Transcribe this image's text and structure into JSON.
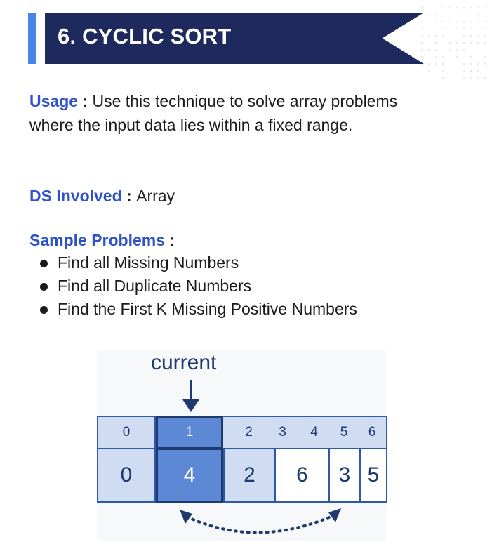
{
  "section": {
    "title": "6. CYCLIC SORT"
  },
  "usage": {
    "label": "Usage",
    "separator": " : ",
    "text": "Use this technique to solve array problems where the input data lies within a fixed range."
  },
  "ds_involved": {
    "label": "DS Involved",
    "separator": " : ",
    "value": "Array"
  },
  "sample_problems": {
    "label": "Sample Problems",
    "separator": " :",
    "items": [
      "Find all Missing Numbers",
      "Find all Duplicate Numbers",
      "Find the First K Missing Positive Numbers"
    ]
  },
  "diagram": {
    "pointer_label": "current",
    "indices": [
      "0",
      "1",
      "2",
      "3",
      "4",
      "5",
      "6"
    ],
    "values": [
      "0",
      "4",
      "2",
      "6",
      "3",
      "5"
    ],
    "current_index": 1,
    "colors": {
      "light_cell": "#cfdcf2",
      "active_cell": "#5d88d6",
      "border": "#2d5aa8",
      "text": "#1e3a6e"
    }
  },
  "colors": {
    "banner": "#1e2a5e",
    "banner_accent": "#4a86e8",
    "keyword": "#2f52c7"
  }
}
